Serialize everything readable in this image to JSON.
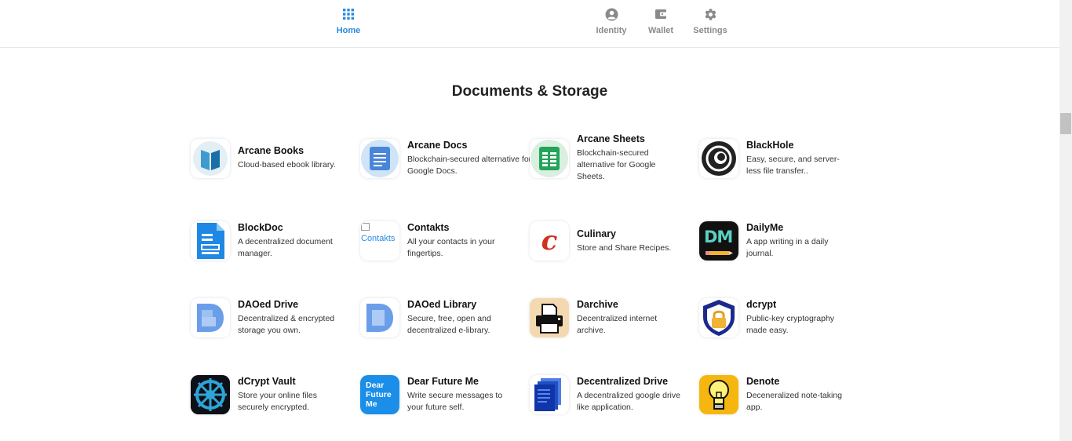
{
  "nav": {
    "home": "Home",
    "identity": "Identity",
    "wallet": "Wallet",
    "settings": "Settings"
  },
  "colors": {
    "accent": "#2a8be0",
    "nav_inactive": "#8a8a8a"
  },
  "section": {
    "title": "Documents & Storage"
  },
  "apps": [
    {
      "name": "Arcane Books",
      "desc": "Cloud-based ebook library.",
      "icon": "book-icon"
    },
    {
      "name": "Arcane Docs",
      "desc": "Blockchain-secured alternative for Google Docs.",
      "icon": "document-icon"
    },
    {
      "name": "Arcane Sheets",
      "desc": "Blockchain-secured alternative for Google Sheets.",
      "icon": "spreadsheet-icon"
    },
    {
      "name": "BlackHole",
      "desc": "Easy, secure, and server-less file transfer..",
      "icon": "blackhole-icon"
    },
    {
      "name": "BlockDoc",
      "desc": "A decentralized document manager.",
      "icon": "file-icon"
    },
    {
      "name": "Contakts",
      "desc": "All your contacts in your fingertips.",
      "icon": "broken-image-icon",
      "alt": "Contakts"
    },
    {
      "name": "Culinary",
      "desc": "Store and Share Recipes.",
      "icon": "culinary-c-icon",
      "glyph": "c"
    },
    {
      "name": "DailyMe",
      "desc": "A app writing in a daily journal.",
      "icon": "dailyme-icon",
      "glyph": "DM"
    },
    {
      "name": "DAOed Drive",
      "desc": "Decentralized & encrypted storage you own.",
      "icon": "daoed-d-icon"
    },
    {
      "name": "DAOed Library",
      "desc": "Secure, free, open and decentralized e-library.",
      "icon": "daoed-d-icon"
    },
    {
      "name": "Darchive",
      "desc": "Decentralized internet archive.",
      "icon": "printer-icon"
    },
    {
      "name": "dcrypt",
      "desc": "Public-key cryptography made easy.",
      "icon": "shield-lock-icon"
    },
    {
      "name": "dCrypt Vault",
      "desc": "Store your online files securely encrypted.",
      "icon": "vault-wheel-icon"
    },
    {
      "name": "Dear Future Me",
      "desc": "Write secure messages to your future self.",
      "icon": "dear-future-me-icon",
      "glyph": "Dear Future Me"
    },
    {
      "name": "Decentralized Drive",
      "desc": "A decentralized google drive like application.",
      "icon": "drive-files-icon"
    },
    {
      "name": "Denote",
      "desc": "Deceneralized note-taking app.",
      "icon": "lightbulb-icon"
    }
  ]
}
